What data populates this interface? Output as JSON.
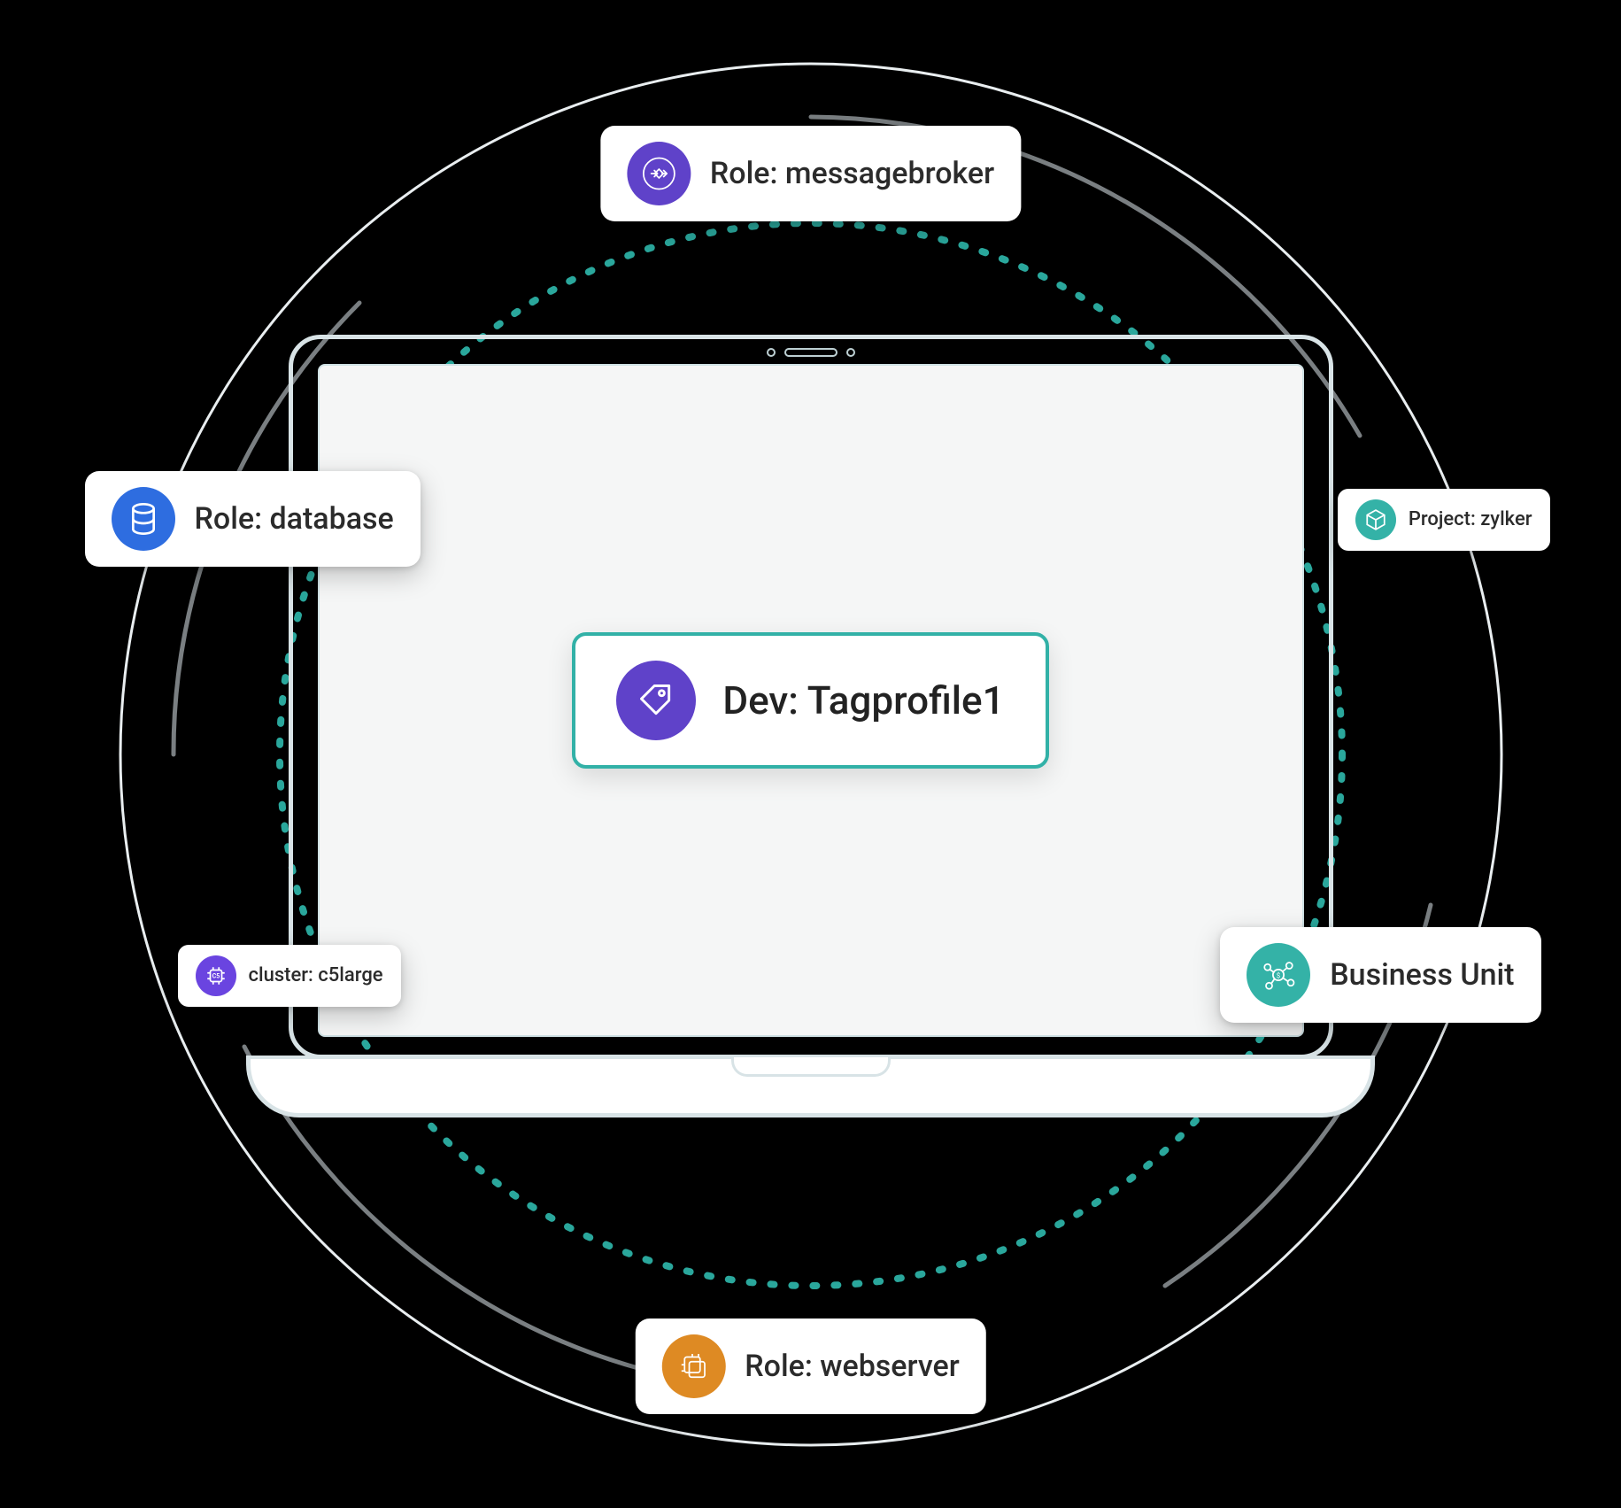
{
  "center": {
    "label": "Dev: Tagprofile1"
  },
  "cards": {
    "top": {
      "label": "Role: messagebroker"
    },
    "left": {
      "label": "Role: database"
    },
    "right": {
      "label": "Project: zylker"
    },
    "bu": {
      "label": "Business Unit"
    },
    "cluster": {
      "label": "cluster: c5large"
    },
    "bottom": {
      "label": "Role: webserver"
    }
  }
}
